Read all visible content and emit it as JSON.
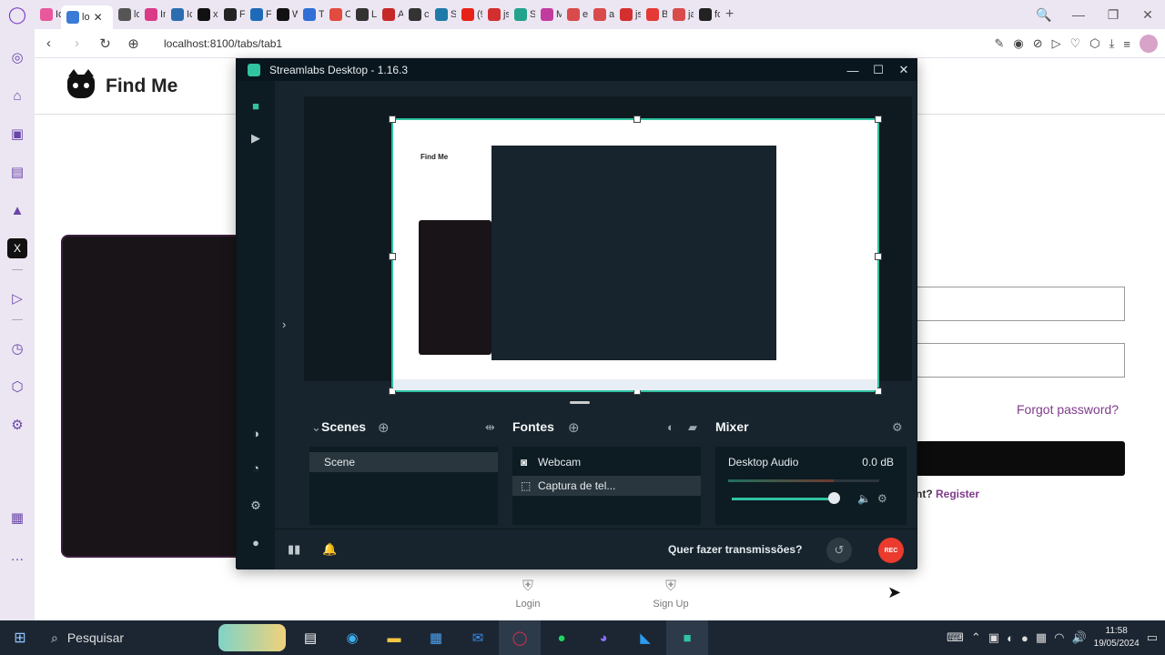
{
  "browser": {
    "tabs": [
      {
        "label": "Io",
        "color": "#e9579c",
        "active": false
      },
      {
        "label": "lo",
        "color": "#3b7bd6",
        "active": true
      },
      {
        "label": "lo",
        "color": "#555555",
        "active": false
      },
      {
        "label": "In",
        "color": "#d93b86",
        "active": false
      },
      {
        "label": "Ic",
        "color": "#2c6db0",
        "active": false
      },
      {
        "label": "x.",
        "color": "#111111",
        "active": false
      },
      {
        "label": "Fr",
        "color": "#222222",
        "active": false
      },
      {
        "label": "Fe",
        "color": "#1d6bb8",
        "active": false
      },
      {
        "label": "W",
        "color": "#111111",
        "active": false
      },
      {
        "label": "Te",
        "color": "#2f6fd6",
        "active": false
      },
      {
        "label": "C",
        "color": "#e24b3f",
        "active": false
      },
      {
        "label": "Li",
        "color": "#333333",
        "active": false
      },
      {
        "label": "A",
        "color": "#c62828",
        "active": false
      },
      {
        "label": "cc",
        "color": "#333333",
        "active": false
      },
      {
        "label": "St",
        "color": "#1f7aa8",
        "active": false
      },
      {
        "label": "(9",
        "color": "#e62117",
        "active": false
      },
      {
        "label": "js",
        "color": "#d32f2f",
        "active": false
      },
      {
        "label": "Sc",
        "color": "#22a38b",
        "active": false
      },
      {
        "label": "M",
        "color": "#c23c9e",
        "active": false
      },
      {
        "label": "ec",
        "color": "#d94b4b",
        "active": false
      },
      {
        "label": "ar",
        "color": "#d94b4b",
        "active": false
      },
      {
        "label": "js",
        "color": "#d32f2f",
        "active": false
      },
      {
        "label": "Bi",
        "color": "#e53935",
        "active": false
      },
      {
        "label": "ja",
        "color": "#d94b4b",
        "active": false
      },
      {
        "label": "fc",
        "color": "#222222",
        "active": false
      }
    ],
    "new_tab": "+",
    "url": "localhost:8100/tabs/tab1",
    "window_controls": {
      "search": "🔍",
      "minimize": "—",
      "restore": "❐",
      "close": "✕"
    }
  },
  "page": {
    "brand": "Find Me",
    "forgot": "Forgot password?",
    "register_prefix": "nt?",
    "register_link": "Register",
    "nav": [
      {
        "label": "Login",
        "icon": "login-icon"
      },
      {
        "label": "Sign Up",
        "icon": "signup-icon"
      }
    ]
  },
  "streamlabs": {
    "title": "Streamlabs Desktop - 1.16.3",
    "preview": {
      "inner_title": "Find Me"
    },
    "scenes": {
      "title": "Scenes",
      "items": [
        "Scene"
      ]
    },
    "sources": {
      "title": "Fontes",
      "items": [
        "Webcam",
        "Captura de tel..."
      ]
    },
    "mixer": {
      "title": "Mixer",
      "channel": "Desktop Audio",
      "level": "0.0 dB",
      "volume_fraction": 0.82
    },
    "footer": {
      "stream_question": "Quer fazer transmissões?",
      "rec": "REC"
    }
  },
  "taskbar": {
    "search": "Pesquisar",
    "time": "11:58",
    "date": "19/05/2024"
  },
  "colors": {
    "accent": "#31c3a2",
    "rec": "#ea3b2e",
    "link": "#7e3b8a"
  }
}
